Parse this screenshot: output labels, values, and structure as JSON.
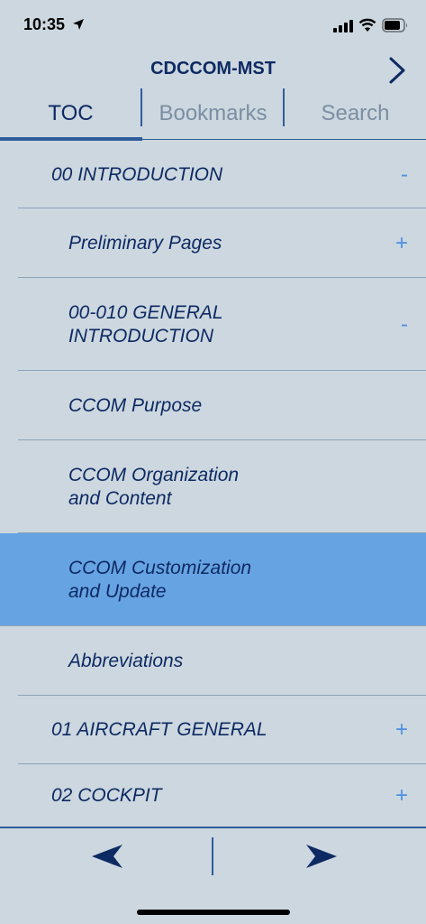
{
  "status_bar": {
    "time": "10:35"
  },
  "header": {
    "title": "CDCCOM-MST"
  },
  "tabs": [
    {
      "label": "TOC",
      "active": true
    },
    {
      "label": "Bookmarks",
      "active": false
    },
    {
      "label": "Search",
      "active": false
    }
  ],
  "toc": [
    {
      "label": "00 INTRODUCTION",
      "toggle": "-",
      "level": 1,
      "selected": false
    },
    {
      "label": "Preliminary Pages",
      "toggle": "+",
      "level": 2,
      "selected": false
    },
    {
      "label": "00-010 GENERAL\nINTRODUCTION",
      "toggle": "-",
      "level": 2,
      "selected": false
    },
    {
      "label": "CCOM Purpose",
      "toggle": "",
      "level": 2,
      "selected": false
    },
    {
      "label": "CCOM Organization\nand Content",
      "toggle": "",
      "level": 2,
      "selected": false
    },
    {
      "label": "CCOM Customization\nand Update",
      "toggle": "",
      "level": 2,
      "selected": true
    },
    {
      "label": "Abbreviations",
      "toggle": "",
      "level": 2,
      "selected": false
    },
    {
      "label": "01 AIRCRAFT GENERAL",
      "toggle": "+",
      "level": 1,
      "selected": false
    },
    {
      "label": "02 COCKPIT",
      "toggle": "+",
      "level": 1,
      "selected": false
    }
  ],
  "icons": {
    "forward": "chevron-right-icon",
    "prev": "arrow-left-icon",
    "next": "arrow-right-icon"
  },
  "colors": {
    "background": "#ccd7df",
    "primary": "#0e2a63",
    "accent": "#2f5d9b",
    "selected_row": "#66a3e3",
    "toggle": "#4d90e0",
    "inactive_tab": "#7c8ea3"
  }
}
